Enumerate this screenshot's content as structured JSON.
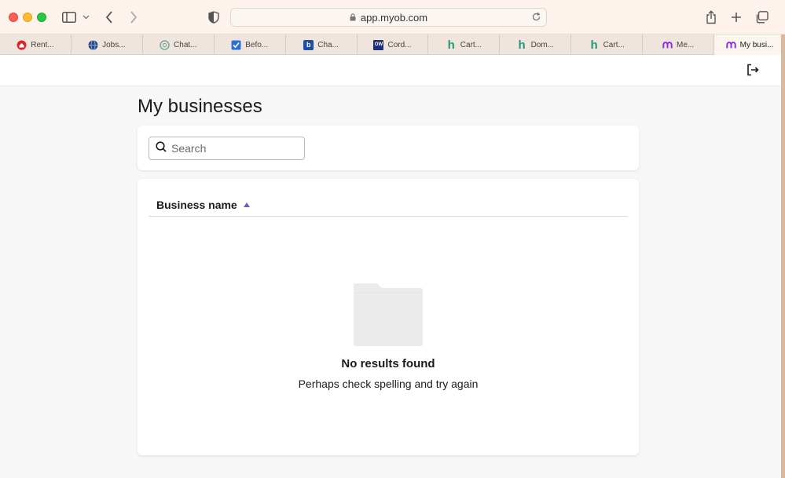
{
  "browser": {
    "url": "app.myob.com",
    "tabs": [
      {
        "label": "Rent...",
        "icon": "rent-favicon",
        "color": "#d8282d"
      },
      {
        "label": "Jobs...",
        "icon": "jobs-favicon",
        "color": "#2a4a8c"
      },
      {
        "label": "Chat...",
        "icon": "chatgpt-favicon",
        "color": "#74aa9c"
      },
      {
        "label": "Befo...",
        "icon": "checkbox-favicon",
        "color": "#2f6fd1"
      },
      {
        "label": "Cha...",
        "icon": "b-favicon",
        "color": "#1e4fa3"
      },
      {
        "label": "Cord...",
        "icon": "ow-favicon",
        "color": "#1b2f86"
      },
      {
        "label": "Cart...",
        "icon": "h-favicon",
        "color": "#1f9a7a"
      },
      {
        "label": "Dom...",
        "icon": "h-favicon",
        "color": "#1f9a7a"
      },
      {
        "label": "Cart...",
        "icon": "h-favicon",
        "color": "#1f9a7a"
      },
      {
        "label": "Me...",
        "icon": "myob-favicon",
        "color": "#8a2be2"
      },
      {
        "label": "My busi...",
        "icon": "myob-favicon",
        "color": "#8a2be2"
      }
    ]
  },
  "page": {
    "title": "My businesses",
    "search_placeholder": "Search",
    "column_header": "Business name",
    "empty_title": "No results found",
    "empty_subtitle": "Perhaps check spelling and try again"
  },
  "colors": {
    "accent": "#7b4fd0",
    "folder": "#ebebeb"
  }
}
